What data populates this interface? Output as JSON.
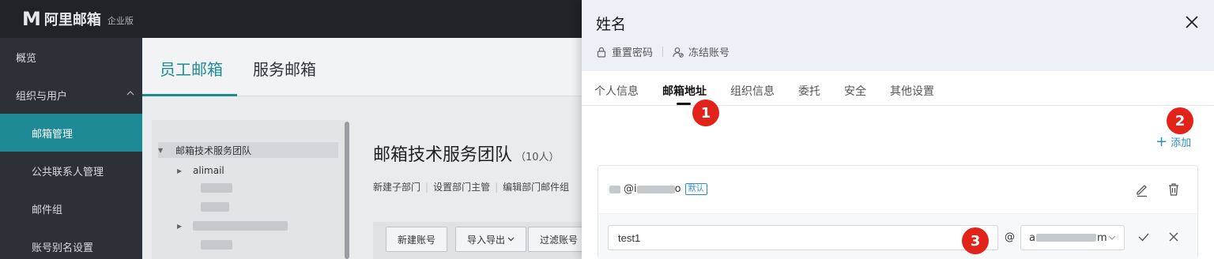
{
  "app": {
    "logo_mark": "M",
    "logo_text": "阿里邮箱",
    "logo_sub": "企业版"
  },
  "sidebar": {
    "items": [
      {
        "label": "概览"
      },
      {
        "label": "组织与用户"
      },
      {
        "label": "邮箱管理"
      },
      {
        "label": "公共联系人管理"
      },
      {
        "label": "邮件组"
      },
      {
        "label": "账号别名设置"
      }
    ],
    "active_index": 2
  },
  "content": {
    "tabs": [
      {
        "label": "员工邮箱"
      },
      {
        "label": "服务邮箱"
      }
    ],
    "tree": {
      "root": "邮箱技术服务团队",
      "child": "alimail"
    },
    "department": {
      "title": "邮箱技术服务团队",
      "count": "（10人）",
      "actions": [
        "新建子部门",
        "设置部门主管",
        "编辑部门邮件组"
      ]
    },
    "buttons": [
      "新建账号",
      "导入导出",
      "过滤账号"
    ]
  },
  "drawer": {
    "title": "姓名",
    "header_actions": [
      {
        "label": "重置密码",
        "icon": "lock-icon"
      },
      {
        "label": "冻结账号",
        "icon": "user-freeze-icon"
      }
    ],
    "tabs": [
      {
        "label": "个人信息"
      },
      {
        "label": "邮箱地址"
      },
      {
        "label": "组织信息"
      },
      {
        "label": "委托"
      },
      {
        "label": "安全"
      },
      {
        "label": "其他设置"
      }
    ],
    "active_tab_index": 1,
    "add_label": "添加",
    "address": {
      "email_prefix": "@i",
      "email_suffix": "o",
      "default_tag": "默认"
    },
    "new_address": {
      "input_value": "test1",
      "at": "@",
      "domain_start": "a",
      "domain_end": "m"
    },
    "annotations": [
      "1",
      "2",
      "3"
    ]
  },
  "colors": {
    "accent": "#1d8a96",
    "link": "#2b8ec9",
    "badge": "#e2231a",
    "header_bg": "#eef0f8"
  }
}
